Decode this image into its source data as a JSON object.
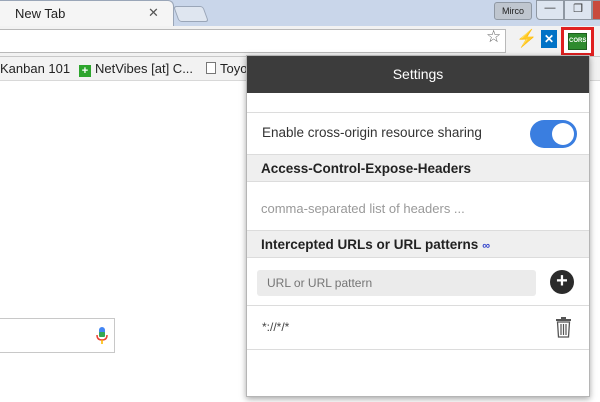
{
  "tab": {
    "title": "New Tab",
    "close": "✕"
  },
  "profile": {
    "name": "Mirco"
  },
  "window": {
    "minimize": "—",
    "maximize": "❐"
  },
  "toolbar": {
    "star_icon": "☆",
    "ext1_icon": "⚡",
    "ext2_label": "✕",
    "cors_label": "CORS"
  },
  "bookmarks": [
    {
      "label": "Kanban 101",
      "icon": "none"
    },
    {
      "label": "NetVibes [at] C...",
      "icon": "green-plus"
    },
    {
      "label": "Toyo",
      "icon": "page"
    }
  ],
  "settings": {
    "title": "Settings",
    "enable_label": "Enable cross-origin resource sharing",
    "enabled": true,
    "expose_headers_title": "Access-Control-Expose-Headers",
    "expose_headers_placeholder": "comma-separated list of headers ...",
    "intercepted_title": "Intercepted URLs or URL patterns",
    "link_icon": "∞",
    "url_placeholder": "URL or URL pattern",
    "add_icon": "+",
    "patterns": [
      "*://*/*"
    ]
  },
  "colors": {
    "accent": "#3a7ee0",
    "header_bg": "#3c3c3c",
    "highlight": "#e02020"
  }
}
